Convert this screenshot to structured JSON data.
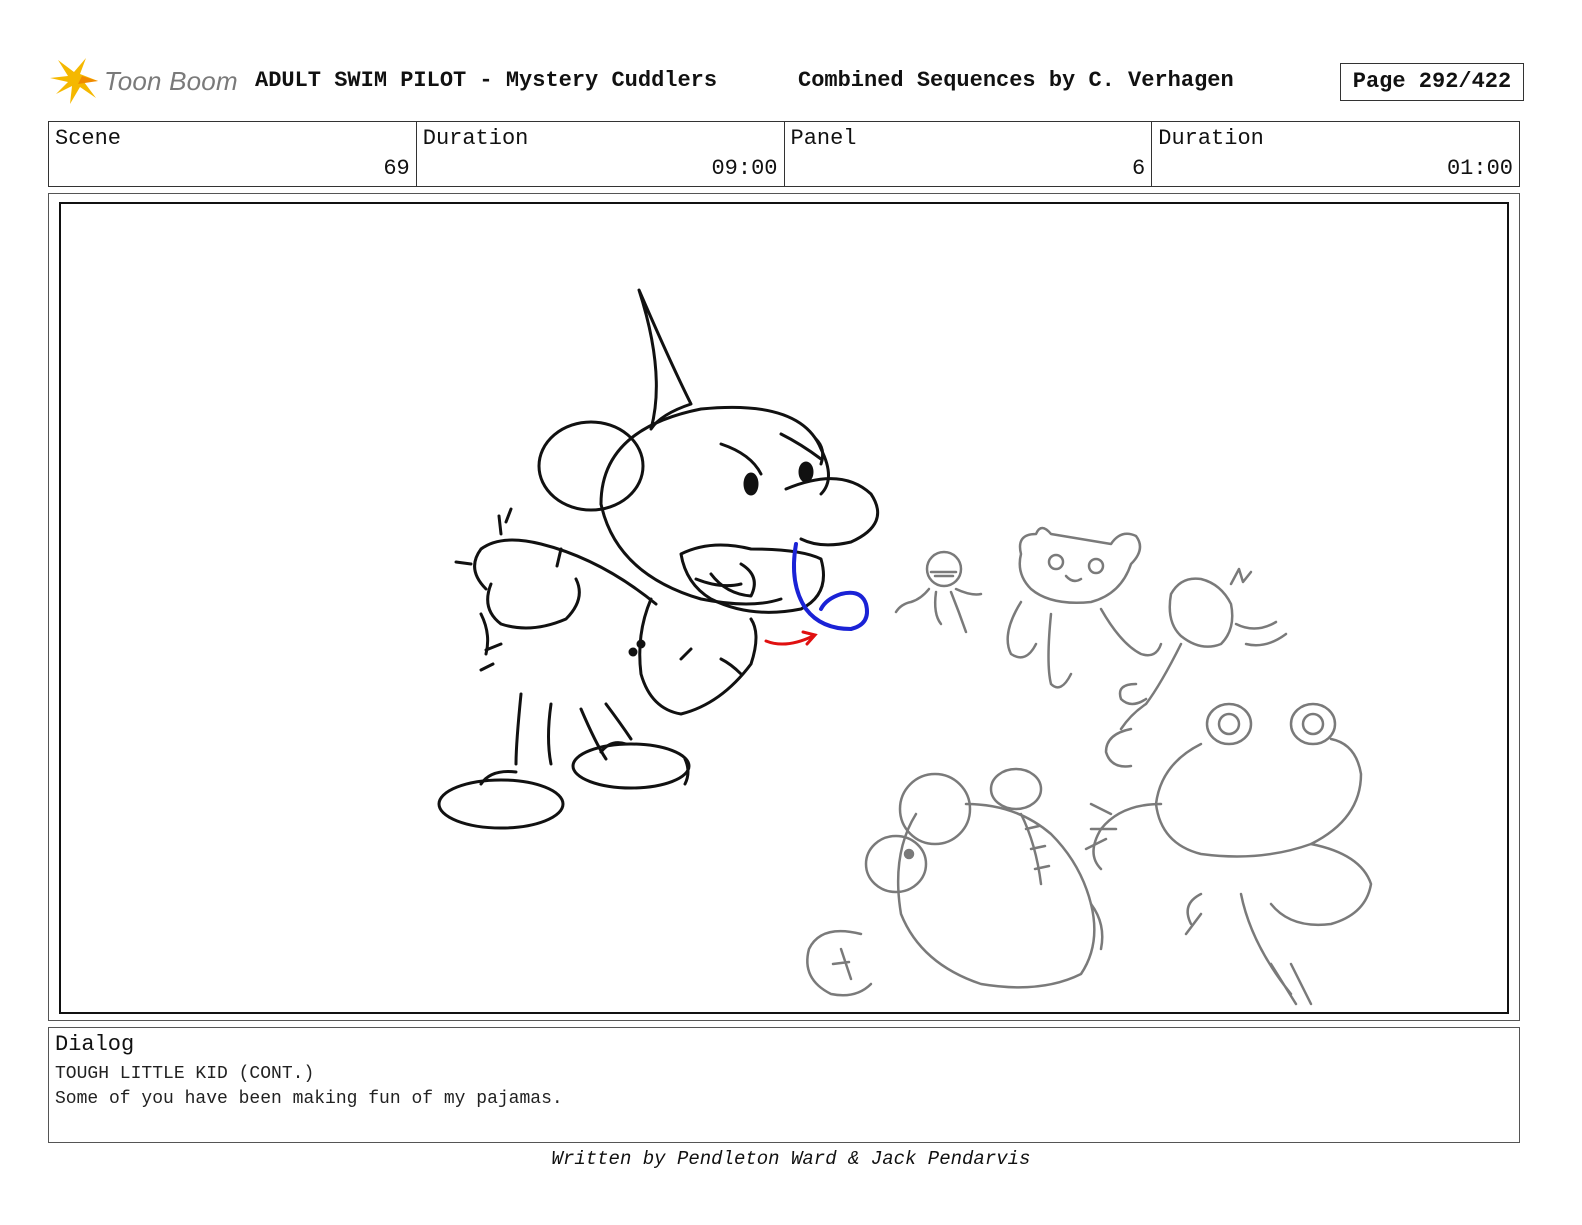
{
  "header": {
    "logo_text": "Toon Boom",
    "title": "ADULT SWIM PILOT - Mystery Cuddlers",
    "subtitle": "Combined Sequences by C. Verhagen",
    "page": "Page 292/422"
  },
  "info": {
    "scene_label": "Scene",
    "scene_value": "69",
    "scene_duration_label": "Duration",
    "scene_duration_value": "09:00",
    "panel_label": "Panel",
    "panel_value": "6",
    "panel_duration_label": "Duration",
    "panel_duration_value": "01:00"
  },
  "dialog": {
    "label": "Dialog",
    "character": "TOUGH LITTLE KID (CONT.)",
    "line": "Some of you have been making fun of my pajamas."
  },
  "footer": {
    "credit": "Written by Pendleton Ward & Jack Pendarvis"
  },
  "colors": {
    "accent_logo": "#f5b800",
    "sketch_dark": "#111111",
    "sketch_gray": "#7a7a7a",
    "annotation_blue": "#1a22d6",
    "annotation_red": "#e01010"
  }
}
